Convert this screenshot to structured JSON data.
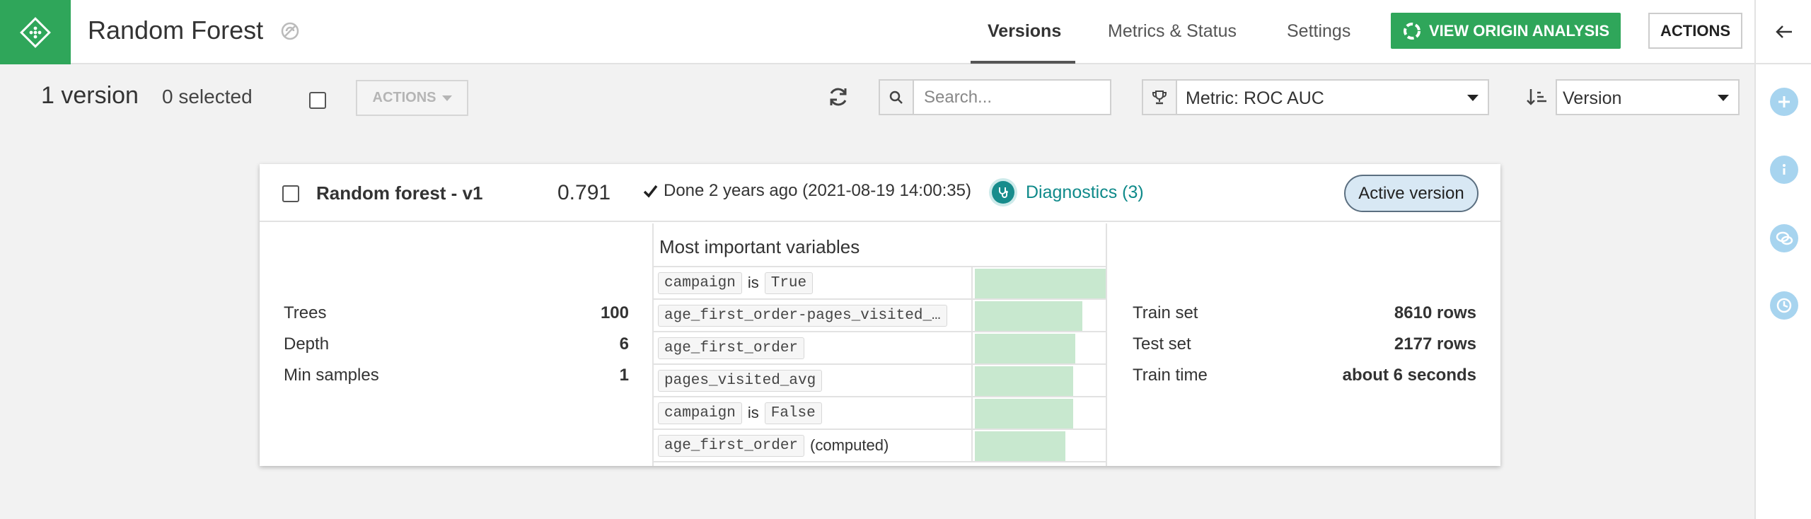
{
  "header": {
    "title": "Random Forest",
    "tabs": [
      {
        "label": "Versions",
        "active": true
      },
      {
        "label": "Metrics & Status",
        "active": false
      },
      {
        "label": "Settings",
        "active": false
      }
    ],
    "origin_button": "VIEW ORIGIN ANALYSIS",
    "actions_button": "ACTIONS"
  },
  "toolbar": {
    "count": "1 version",
    "selected": "0 selected",
    "actions_label": "ACTIONS",
    "search_placeholder": "Search...",
    "metric_label": "Metric: ROC AUC",
    "sort_label": "Version"
  },
  "card": {
    "name": "Random forest - v1",
    "score": "0.791",
    "status": "Done 2 years ago (2021-08-19 14:00:35)",
    "diagnostics": "Diagnostics (3)",
    "badge": "Active version",
    "params": [
      {
        "label": "Trees",
        "value": "100"
      },
      {
        "label": "Depth",
        "value": "6"
      },
      {
        "label": "Min samples",
        "value": "1"
      }
    ],
    "variables_title": "Most important variables",
    "variables": [
      {
        "name": "campaign",
        "connector": "is",
        "value": "True",
        "suffix": "",
        "importance": 1.0
      },
      {
        "name": "age_first_order-pages_visited_…",
        "connector": "",
        "value": "",
        "suffix": "",
        "importance": 0.82
      },
      {
        "name": "age_first_order",
        "connector": "",
        "value": "",
        "suffix": "",
        "importance": 0.77
      },
      {
        "name": "pages_visited_avg",
        "connector": "",
        "value": "",
        "suffix": "",
        "importance": 0.75
      },
      {
        "name": "campaign",
        "connector": "is",
        "value": "False",
        "suffix": "",
        "importance": 0.75
      },
      {
        "name": "age_first_order",
        "connector": "",
        "value": "",
        "suffix": "(computed)",
        "importance": 0.69
      }
    ],
    "train": [
      {
        "label": "Train set",
        "value": "8610 rows"
      },
      {
        "label": "Test set",
        "value": "2177 rows"
      },
      {
        "label": "Train time",
        "value": "about 6 seconds"
      }
    ]
  },
  "colors": {
    "brand": "#2fa65a",
    "diagnostics": "#0f8a8a",
    "bar": "#c8e8cf",
    "rail_button": "#a7d4ef"
  }
}
